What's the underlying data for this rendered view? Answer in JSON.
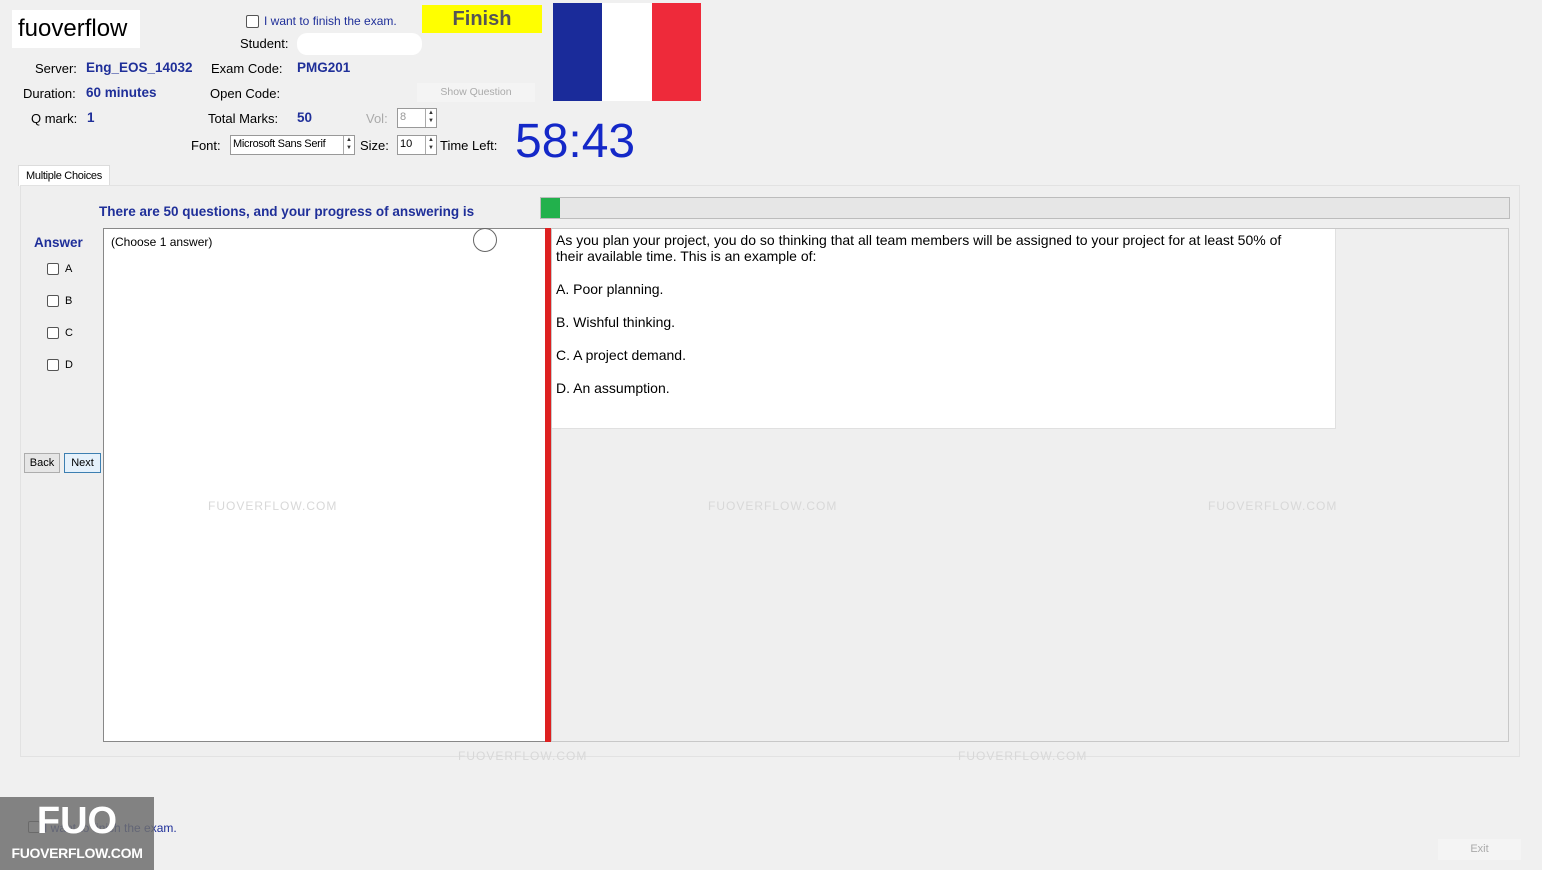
{
  "header": {
    "brand": "fuoverflow",
    "finish_check_label": "I want to finish the exam.",
    "finish_button": "Finish",
    "student_label": "Student:",
    "server_label": "Server:",
    "server_value": "Eng_EOS_14032",
    "exam_code_label": "Exam Code:",
    "exam_code_value": "PMG201",
    "duration_label": "Duration:",
    "duration_value": "60 minutes",
    "open_code_label": "Open Code:",
    "show_question_button": "Show Question",
    "qmark_label": "Q mark:",
    "qmark_value": "1",
    "total_marks_label": "Total Marks:",
    "total_marks_value": "50",
    "vol_label": "Vol:",
    "vol_value": "8",
    "font_label": "Font:",
    "font_value": "Microsoft Sans Serif",
    "size_label": "Size:",
    "size_value": "10",
    "time_left_label": "Time Left:",
    "timer": "58:43"
  },
  "flag_colors": {
    "blue": "#1a2b9a",
    "white": "#ffffff",
    "red": "#ee2a3a"
  },
  "tabs": [
    {
      "label": "Multiple Choices"
    }
  ],
  "progress": {
    "text": "There are 50 questions, and your progress of answering is",
    "fraction": 0.02,
    "color": "#22b14c"
  },
  "answer": {
    "title": "Answer",
    "options": [
      {
        "label": "A"
      },
      {
        "label": "B"
      },
      {
        "label": "C"
      },
      {
        "label": "D"
      }
    ],
    "back_button": "Back",
    "next_button": "Next",
    "hint": "(Choose 1 answer)"
  },
  "question": {
    "stem": "As you plan your project, you do so thinking that all team members will be assigned to your project for at least 50% of their available time. This is an example of:",
    "choices": [
      {
        "text": "A.  Poor planning."
      },
      {
        "text": "B.  Wishful thinking."
      },
      {
        "text": "C.  A project demand."
      },
      {
        "text": "D.  An assumption."
      }
    ]
  },
  "footer": {
    "logo_text": "FUO",
    "logo_sub": "FUOVERFLOW.COM",
    "finish_check_label": "I want to finish the exam.",
    "exit_button": "Exit"
  },
  "watermark": "FUOVERFLOW.COM"
}
